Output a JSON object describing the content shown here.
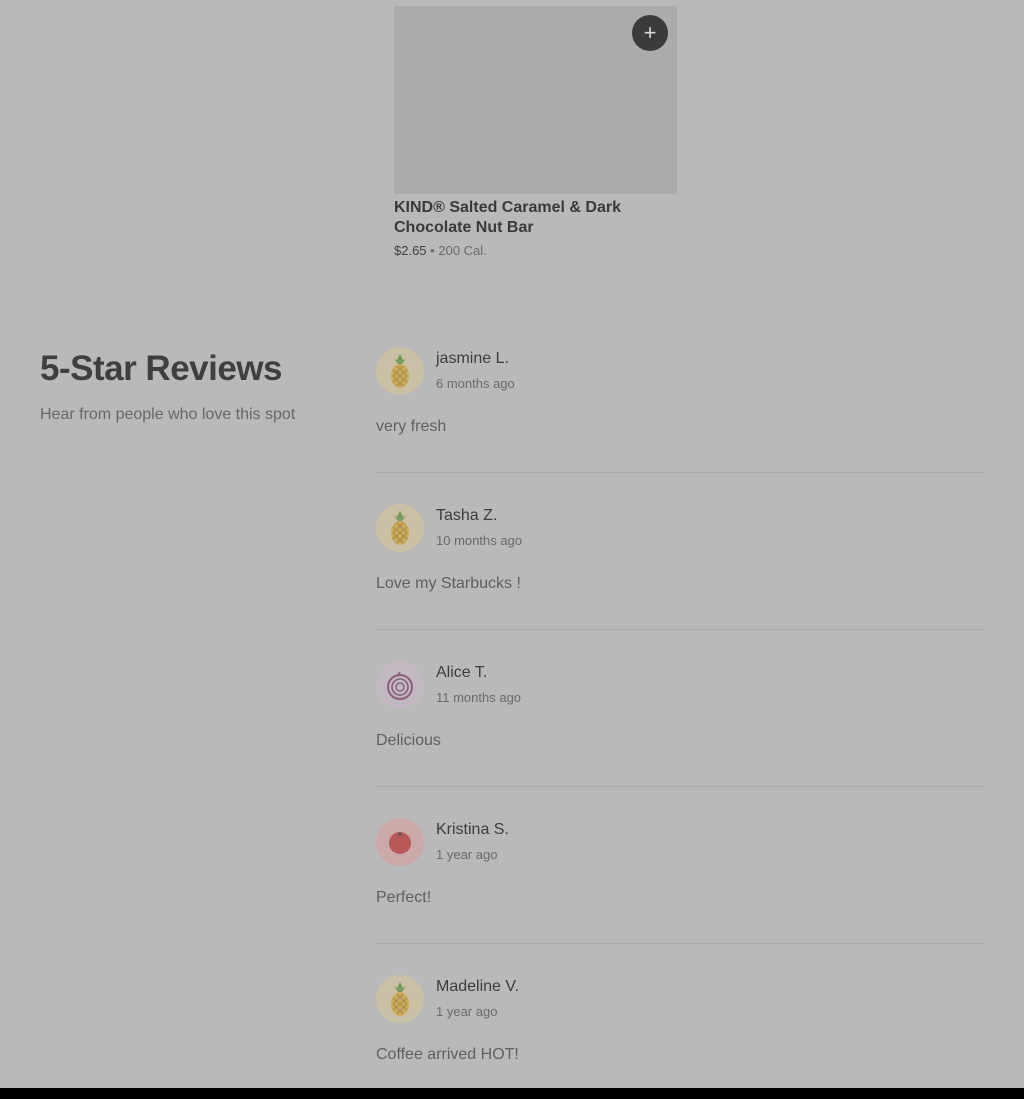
{
  "product": {
    "add_label": "+",
    "name": "KIND® Salted Caramel & Dark Chocolate Nut Bar",
    "price": "$2.65",
    "separator": "•",
    "calories": "200 Cal."
  },
  "reviews": {
    "title": "5-Star Reviews",
    "subtitle": "Hear from people who love this spot",
    "items": [
      {
        "name": "jasmine L.",
        "time": "6 months ago",
        "text": "very fresh",
        "avatar_icon": "pineapple-icon",
        "avatar_bg": "#c9c0a5"
      },
      {
        "name": "Tasha Z.",
        "time": "10 months ago",
        "text": "Love my Starbucks !",
        "avatar_icon": "pineapple-icon",
        "avatar_bg": "#c9c0a5"
      },
      {
        "name": "Alice T.",
        "time": "11 months ago",
        "text": "Delicious",
        "avatar_icon": "onion-icon",
        "avatar_bg": "#c2b8c1"
      },
      {
        "name": "Kristina S.",
        "time": "1 year ago",
        "text": "Perfect!",
        "avatar_icon": "tomato-icon",
        "avatar_bg": "#cba9a9"
      },
      {
        "name": "Madeline V.",
        "time": "1 year ago",
        "text": "Coffee arrived HOT!",
        "avatar_icon": "pineapple-icon",
        "avatar_bg": "#c9c0a5"
      }
    ]
  }
}
